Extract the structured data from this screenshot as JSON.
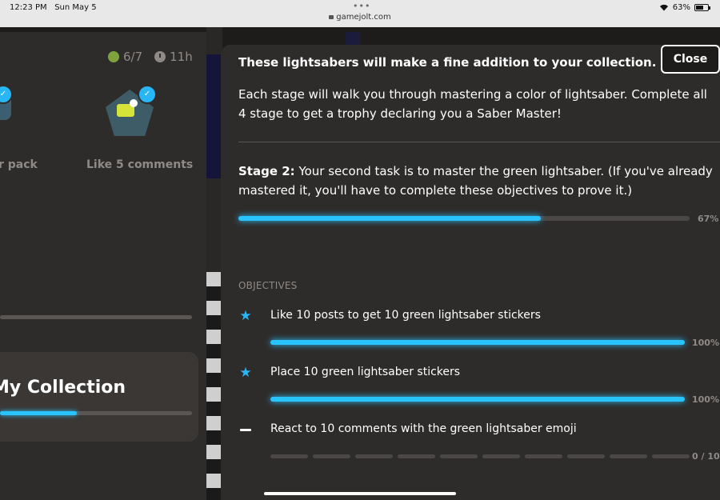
{
  "status_bar": {
    "time": "12:23 PM",
    "date": "Sun May 5",
    "url": "gamejolt.com",
    "battery": "63%",
    "battery_level": 0.63
  },
  "left_panel": {
    "progress_count": "6/7",
    "time_left": "11h",
    "partial_label": "r pack",
    "badge_label": "Like 5 comments",
    "collection_title": "My Collection",
    "collection_progress": 0.4
  },
  "modal": {
    "close_label": "Close",
    "heading": "These lightsabers will make a fine addition to your collection.",
    "description": "Each stage will walk you through mastering a color of lightsaber. Complete all 4 stage to get a trophy declaring you a Saber Master!",
    "stage_label": "Stage 2:",
    "stage_text": " Your second task is to master the green lightsaber. (If you've already mastered it, you'll have to complete these objectives to prove it.)",
    "stage_progress": 0.67,
    "stage_percent": "67%",
    "objectives_heading": "OBJECTIVES",
    "objectives": [
      {
        "icon": "star-icon",
        "label": "Like 10 posts to get 10 green lightsaber stickers",
        "progress": 1.0,
        "status": "100%"
      },
      {
        "icon": "star-icon",
        "label": "Place 10 green lightsaber stickers",
        "progress": 1.0,
        "status": "100%"
      },
      {
        "icon": "dash-icon",
        "label": "React to 10 comments with the green lightsaber emoji",
        "progress": 0,
        "segments": 10,
        "status": "0 / 10"
      }
    ]
  },
  "colors": {
    "accent": "#29c3ff",
    "panel": "#2e2c2b",
    "muted": "#8f8a86"
  }
}
